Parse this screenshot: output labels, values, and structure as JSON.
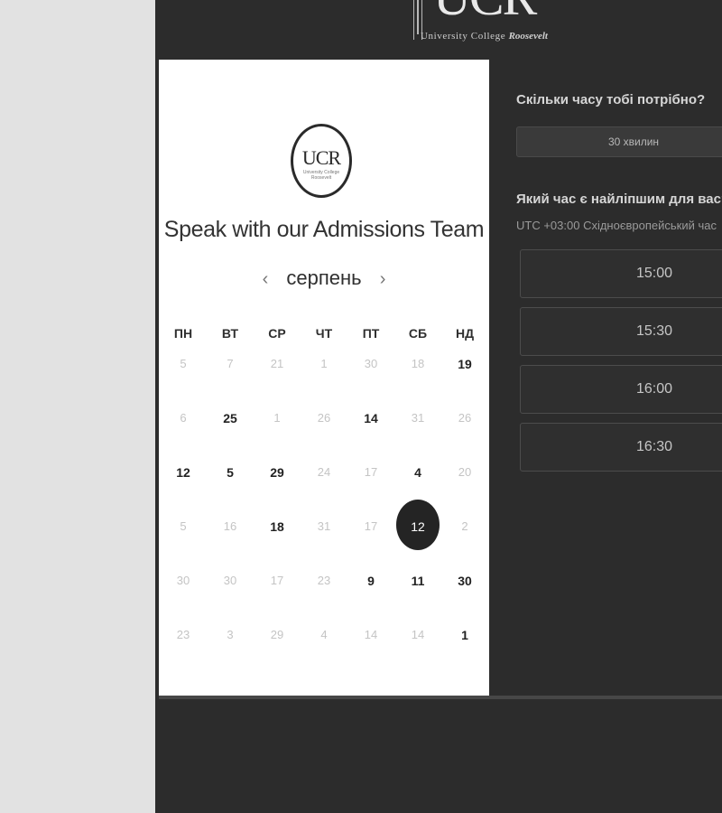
{
  "header": {
    "brand_letters": "UCR",
    "brand_sub_plain": "University College",
    "brand_sub_italic": "Roosevelt"
  },
  "calendar_panel": {
    "logo_text": "UCR",
    "logo_small": "University College Roosevelt",
    "title": "Speak with our Admissions Team",
    "month": "серпень",
    "prev_icon": "‹",
    "next_icon": "›",
    "weekdays": [
      "ПН",
      "ВТ",
      "СР",
      "ЧТ",
      "ПТ",
      "СБ",
      "НД"
    ],
    "weeks": [
      [
        {
          "d": "5",
          "a": false
        },
        {
          "d": "7",
          "a": false
        },
        {
          "d": "21",
          "a": false
        },
        {
          "d": "1",
          "a": false
        },
        {
          "d": "30",
          "a": false
        },
        {
          "d": "18",
          "a": false
        },
        {
          "d": "19",
          "a": true
        }
      ],
      [
        {
          "d": "6",
          "a": false
        },
        {
          "d": "25",
          "a": true
        },
        {
          "d": "1",
          "a": false
        },
        {
          "d": "26",
          "a": false
        },
        {
          "d": "14",
          "a": true
        },
        {
          "d": "31",
          "a": false
        },
        {
          "d": "26",
          "a": false
        }
      ],
      [
        {
          "d": "12",
          "a": true
        },
        {
          "d": "5",
          "a": true
        },
        {
          "d": "29",
          "a": true
        },
        {
          "d": "24",
          "a": false
        },
        {
          "d": "17",
          "a": false
        },
        {
          "d": "4",
          "a": true
        },
        {
          "d": "20",
          "a": false
        }
      ],
      [
        {
          "d": "5",
          "a": false
        },
        {
          "d": "16",
          "a": false
        },
        {
          "d": "18",
          "a": true
        },
        {
          "d": "31",
          "a": false
        },
        {
          "d": "17",
          "a": false
        },
        {
          "d": "12",
          "a": true,
          "selected": true
        },
        {
          "d": "2",
          "a": false
        }
      ],
      [
        {
          "d": "30",
          "a": false
        },
        {
          "d": "30",
          "a": false
        },
        {
          "d": "17",
          "a": false
        },
        {
          "d": "23",
          "a": false
        },
        {
          "d": "9",
          "a": true
        },
        {
          "d": "11",
          "a": true
        },
        {
          "d": "30",
          "a": true
        }
      ],
      [
        {
          "d": "23",
          "a": false
        },
        {
          "d": "3",
          "a": false
        },
        {
          "d": "29",
          "a": false
        },
        {
          "d": "4",
          "a": false
        },
        {
          "d": "14",
          "a": false
        },
        {
          "d": "14",
          "a": false
        },
        {
          "d": "1",
          "a": true
        }
      ]
    ]
  },
  "booking_panel": {
    "duration_question": "Скільки часу тобі потрібно?",
    "duration_value": "30 хвилин",
    "time_question": "Який час є найліпшим для вас?",
    "timezone": "UTC +03:00 Східноєвропейський час",
    "slots": [
      "15:00",
      "15:30",
      "16:00",
      "16:30"
    ]
  },
  "colors": {
    "dark_bg": "#2c2c2c",
    "panel_white": "#ffffff",
    "selected_day_bg": "#242424"
  }
}
